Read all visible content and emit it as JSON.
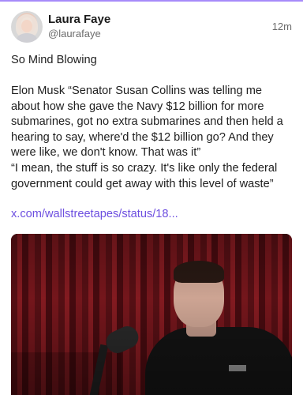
{
  "author": {
    "name": "Laura Faye",
    "handle": "@laurafaye",
    "timestamp": "12m"
  },
  "post": {
    "title": "So Mind Blowing",
    "quote_1": "Elon Musk “Senator Susan Collins was telling me about how she gave the Navy $12 billion for more submarines, got no extra submarines and then held a hearing to say, where'd the $12 billion go? And they were like, we don't know. That was it”",
    "quote_2": "“I mean, the stuff is so crazy. It's like only the federal government could get away with this level of waste”",
    "link_text": "x.com/wallstreetapes/status/18..."
  },
  "theme": {
    "link_color": "#6d4fe0",
    "accent_top": "#a78bfa"
  },
  "media": {
    "icon": "video-thumbnail"
  }
}
